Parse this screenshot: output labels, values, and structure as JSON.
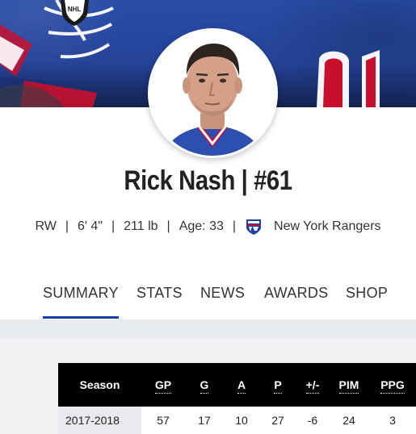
{
  "player": {
    "name": "Rick Nash | #61",
    "position": "RW",
    "height": "6' 4\"",
    "weight": "211 lb",
    "age": "Age: 33",
    "team": "New York Rangers",
    "separator": "|"
  },
  "tabs": [
    {
      "label": "SUMMARY",
      "active": true
    },
    {
      "label": "STATS",
      "active": false
    },
    {
      "label": "NEWS",
      "active": false
    },
    {
      "label": "AWARDS",
      "active": false
    },
    {
      "label": "SHOP",
      "active": false
    }
  ],
  "stats_table": {
    "headers": [
      "Season",
      "GP",
      "G",
      "A",
      "P",
      "+/-",
      "PIM",
      "PPG"
    ],
    "rows": [
      [
        "2017-2018",
        "57",
        "17",
        "10",
        "27",
        "-6",
        "24",
        "3"
      ]
    ]
  },
  "colors": {
    "accent": "#1c3fa8",
    "jersey_blue": "#2a4da8",
    "table_header": "#000000"
  },
  "icons": {
    "team_logo": "new-york-rangers-logo-icon",
    "banner_logo": "nhl-shield-icon"
  }
}
